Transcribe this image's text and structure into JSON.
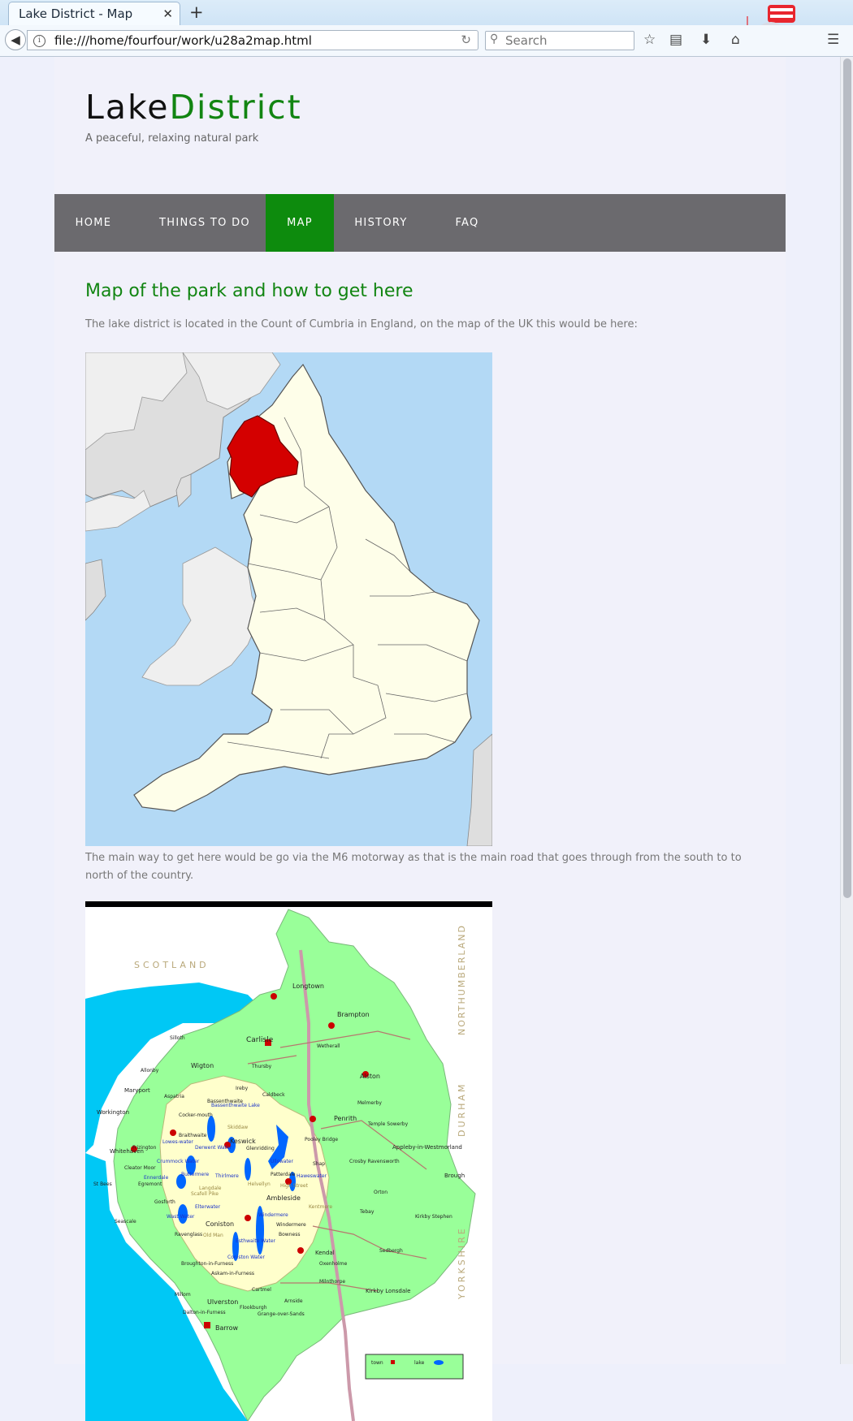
{
  "browser": {
    "tab_title": "Lake District - Map",
    "url": "file:///home/fourfour/work/u28a2map.html",
    "search_placeholder": "Search"
  },
  "site": {
    "title_part1": "Lake",
    "title_part2": "District",
    "tagline": "A peaceful, relaxing natural park"
  },
  "nav": {
    "items": [
      {
        "label": "HOME",
        "active": false
      },
      {
        "label": "THINGS TO DO",
        "active": false
      },
      {
        "label": "MAP",
        "active": true
      },
      {
        "label": "HISTORY",
        "active": false
      },
      {
        "label": "FAQ",
        "active": false
      }
    ]
  },
  "content": {
    "heading": "Map of the park and how to get here",
    "para1": "The lake district is located in the Count of Cumbria in England, on the map of the UK this would be here:",
    "para2": "The main way to get here would be go via the M6 motorway as that is the main road that goes through from the south to to north of the country."
  },
  "map_regional": {
    "scotland": "SCOTLAND",
    "northumberland": "NORTHUMBERLAND",
    "durham": "DURHAM",
    "yorkshire": "YORKSHIRE",
    "towns": [
      "Longtown",
      "Brampton",
      "Carlisle",
      "Wetherall",
      "Silloth",
      "Wigton",
      "Thursby",
      "Allonby",
      "Alston",
      "Maryport",
      "Aspatria",
      "Ireby",
      "Caldbeck",
      "Melmerby",
      "Workington",
      "Cocker-mouth",
      "Bassenthwaite",
      "Skiddaw",
      "Penrith",
      "Temple Sowerby",
      "Keswick",
      "Braithwaite",
      "Pooley Bridge",
      "Appleby-in-Westmorland",
      "Whitehaven",
      "Frizington",
      "Glenridding",
      "Shap",
      "Cleator Moor",
      "Egremont",
      "Patterdale",
      "Brough",
      "St Bees",
      "Ambleside",
      "Orton",
      "Gosforth",
      "Seascale",
      "Coniston",
      "Tebay",
      "Ravenglass",
      "Windermere",
      "Bowness",
      "Kirkby Stephen",
      "Kendal",
      "Sedbergh",
      "Broughton-in-Furness",
      "Oxenholme",
      "Askam-in-Furness",
      "Milnthorpe",
      "Millom",
      "Ulverston",
      "Cartmel",
      "Kirkby Lonsdale",
      "Dalton-in-Furness",
      "Barrow",
      "Grange-over-Sands",
      "Arnside",
      "Flookburgh",
      "Crosby Ravensworth",
      "Helvellyn",
      "High Street",
      "Scafell Pike",
      "Old Man",
      "Kentmere",
      "Langdale"
    ],
    "lakes": [
      "Bassenthwaite Lake",
      "Derwent Water",
      "Lowes-water",
      "Crummock Water",
      "Ennerdale",
      "Buttermere",
      "Thirlmere",
      "Ullswater",
      "Haweswater",
      "Wast Water",
      "Elterwater",
      "Windermere",
      "Coniston Water",
      "Esthwaite Water"
    ],
    "legend": {
      "town": "town",
      "lake": "lake"
    }
  },
  "colors": {
    "brand_green": "#128512",
    "menu_bg": "#6b6a6e",
    "cumbria_highlight": "#d40000",
    "sea": "#b3d9f5",
    "land": "#fefee9"
  }
}
